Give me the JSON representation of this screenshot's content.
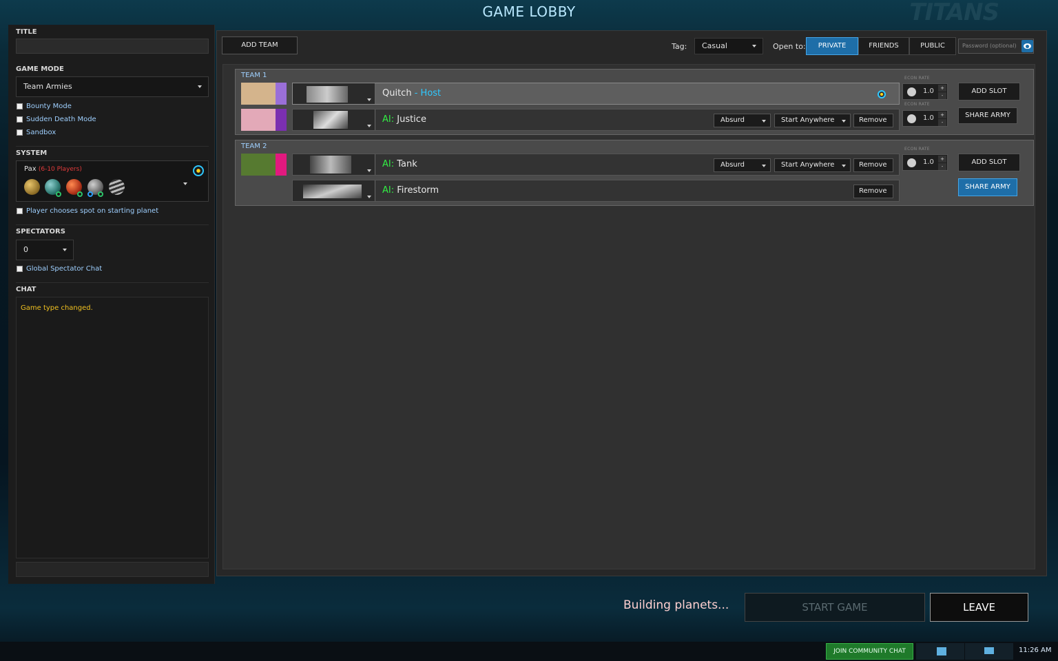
{
  "header": {
    "title": "GAME LOBBY",
    "logo": "TITANS"
  },
  "left": {
    "title_label": "TITLE",
    "title_value": "",
    "game_mode_label": "GAME MODE",
    "game_mode_value": "Team Armies",
    "options": [
      "Bounty Mode",
      "Sudden Death Mode",
      "Sandbox"
    ],
    "system_label": "SYSTEM",
    "system_name": "Pax",
    "system_players": "(6-10 Players)",
    "player_choose": "Player chooses spot on starting planet",
    "spectators_label": "SPECTATORS",
    "spectators_value": "0",
    "global_chat": "Global Spectator Chat",
    "chat_label": "CHAT",
    "chat_message": "Game type changed."
  },
  "topbar": {
    "add_team": "ADD TEAM",
    "tag_label": "Tag:",
    "tag_value": "Casual",
    "open_to_label": "Open to:",
    "private": "PRIVATE",
    "friends": "FRIENDS",
    "public": "PUBLIC",
    "password_placeholder": "Password (optional)"
  },
  "teams": [
    {
      "label": "TEAM 1",
      "add_slot": "ADD SLOT",
      "share_army": "SHARE ARMY",
      "slots": [
        {
          "name": "Quitch",
          "sep": " - ",
          "suffix": "Host",
          "econ_label": "ECON RATE",
          "econ": "1.0",
          "color1": "#d4b48c",
          "color2": "#9a6fd8"
        },
        {
          "prefix": "AI:",
          "name": " Justice",
          "difficulty": "Absurd",
          "start": "Start Anywhere",
          "remove": "Remove",
          "econ_label": "ECON RATE",
          "econ": "1.0",
          "color1": "#e3a9b8",
          "color2": "#7b2fb0"
        }
      ]
    },
    {
      "label": "TEAM 2",
      "add_slot": "ADD SLOT",
      "share_army": "SHARE ARMY",
      "slots": [
        {
          "prefix": "AI:",
          "name": " Tank",
          "difficulty": "Absurd",
          "start": "Start Anywhere",
          "remove": "Remove",
          "econ_label": "ECON RATE",
          "econ": "1.0",
          "color1": "#567a30",
          "color2": "#e2197f"
        },
        {
          "prefix": "AI:",
          "name": " Firestorm",
          "remove": "Remove"
        }
      ]
    }
  ],
  "footer": {
    "status": "Building planets...",
    "start_game": "START GAME",
    "leave": "LEAVE"
  },
  "taskbar": {
    "community_chat": "JOIN COMMUNITY CHAT",
    "time": "11:26 AM"
  },
  "colors": {
    "accent": "#2ec8ff",
    "ai_green": "#33ee44",
    "private_active": "#1e6ea8"
  }
}
